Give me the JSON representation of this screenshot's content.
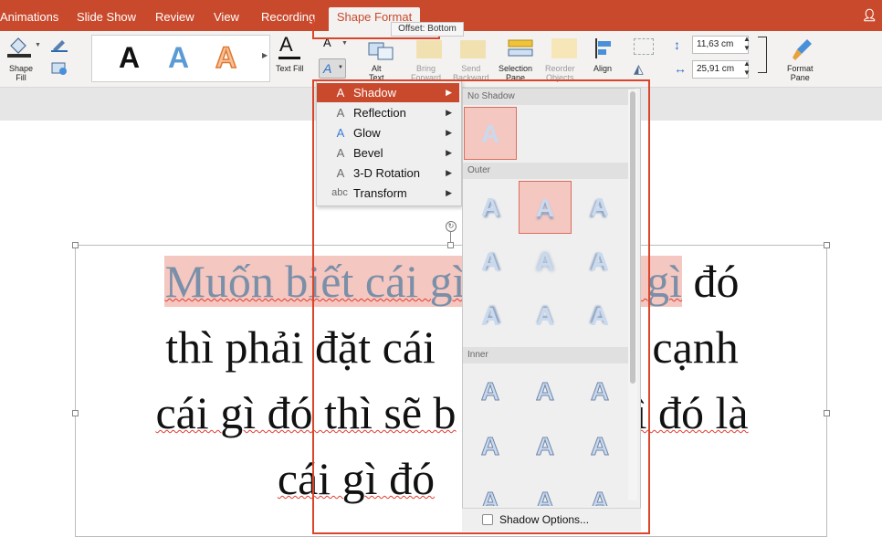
{
  "tabs": {
    "animations": "Animations",
    "slideshow": "Slide Show",
    "review": "Review",
    "view": "View",
    "recording": "Recording",
    "shape_format": "Shape Format"
  },
  "tooltip": "Offset: Bottom",
  "ribbon": {
    "shape_fill": "Shape\nFill",
    "text_fill": "Text Fill",
    "wordart_letter": "A",
    "alt_text": "Alt\nText",
    "bring_forward": "Bring\nForward",
    "send_backward": "Send\nBackward",
    "selection_pane": "Selection\nPane",
    "reorder_objects": "Reorder\nObjects",
    "align": "Align",
    "height_value": "11,63 cm",
    "width_value": "25,91 cm",
    "format_pane": "Format\nPane"
  },
  "slide": {
    "line1_hl_a": "Muốn biết cái gì",
    "line1_hl_b": "ái gì",
    "line1_rest": " đó",
    "line2a": "thì phải đặt cái",
    "line2b": "n cạnh",
    "line3a": "cái gì đó thì sẽ b",
    "line3b": "gì đó là",
    "line4": "cái gì đó"
  },
  "menu": {
    "items": [
      {
        "icon": "A",
        "label": "Shadow"
      },
      {
        "icon": "A",
        "label": "Reflection"
      },
      {
        "icon": "A",
        "label": "Glow"
      },
      {
        "icon": "A",
        "label": "Bevel"
      },
      {
        "icon": "A",
        "label": "3-D Rotation"
      },
      {
        "icon": "abc",
        "label": "Transform"
      }
    ]
  },
  "submenu": {
    "no_shadow": "No Shadow",
    "outer": "Outer",
    "inner": "Inner",
    "cell_letter": "A",
    "shadow_options": "Shadow Options..."
  },
  "colors": {
    "accent": "#c9492c",
    "highlight": "#f4c7c0"
  }
}
